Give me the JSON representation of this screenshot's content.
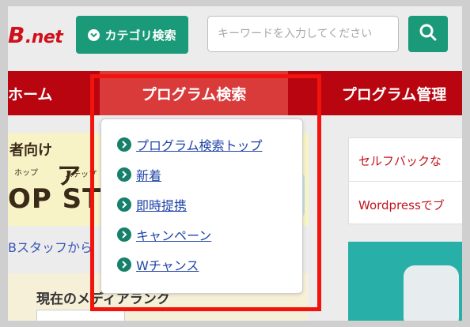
{
  "header": {
    "logo_prefix": "B",
    "logo_text": ".net",
    "category_search_label": "カテゴリ検索",
    "search_placeholder": "キーワードを入力してください"
  },
  "nav": {
    "home": "ホーム",
    "program_search": "プログラム検索",
    "program_manage": "プログラム管理"
  },
  "dropdown": {
    "items": [
      {
        "label": "プログラム検索トップ"
      },
      {
        "label": "新着"
      },
      {
        "label": "即時提携"
      },
      {
        "label": "キャンペーン"
      },
      {
        "label": "Wチャンス"
      }
    ]
  },
  "banner": {
    "line1": "者向け",
    "line2": "ア",
    "ruby1": "ホップ",
    "ruby2": "ステップ",
    "line3": "OP STE"
  },
  "staff_link": "Bスタッフから",
  "media_title": "現在のメディアランク",
  "side_card": {
    "row1": "セルフバックな",
    "row2": "Wordpressでブ"
  },
  "colors": {
    "brand_red": "#b8050f",
    "active_tab": "#d93a3a",
    "teal": "#1a9a78",
    "highlight": "#f2130d",
    "link": "#2044a8"
  }
}
